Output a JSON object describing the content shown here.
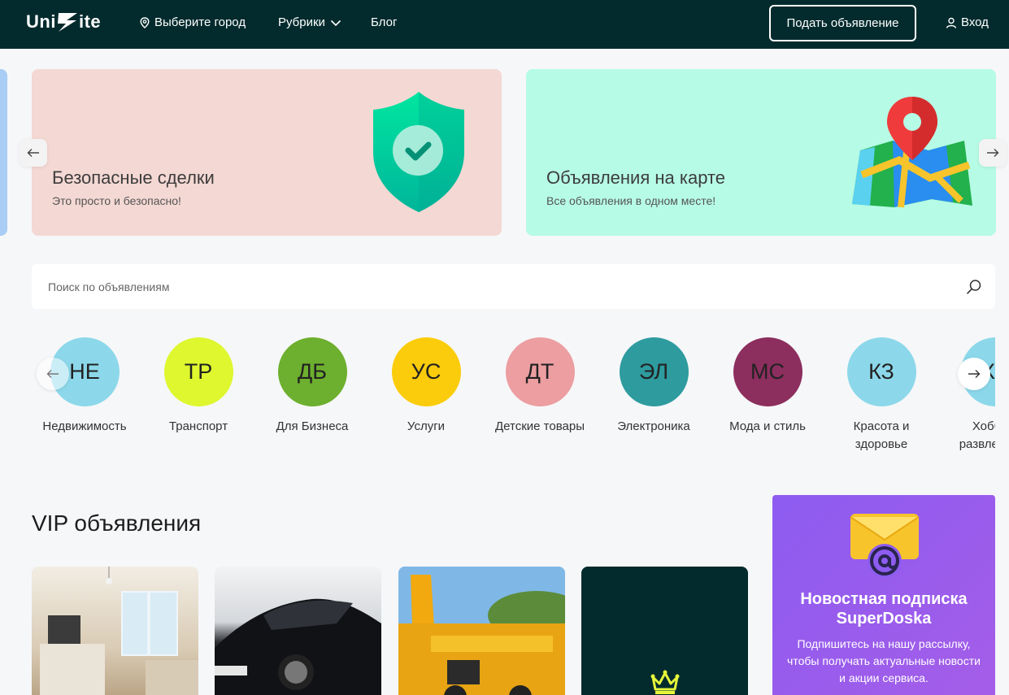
{
  "header": {
    "logo_left": "Uni",
    "logo_right": "ite",
    "city": "Выберите город",
    "rubrics": "Рубрики",
    "blog": "Блог",
    "post_ad": "Подать объявление",
    "login": "Вход"
  },
  "promos": [
    {
      "title": "Безопасные сделки",
      "subtitle": "Это просто и безопасно!",
      "icon": "shield-check-icon",
      "bg": "#f4d8d3"
    },
    {
      "title": "Объявления на карте",
      "subtitle": "Все объявления в одном месте!",
      "icon": "map-pin-icon",
      "bg": "#b6fbe5"
    }
  ],
  "search": {
    "placeholder": "Поиск по объявлениям",
    "value": ""
  },
  "categories": [
    {
      "abbr": "НЕ",
      "label": "Недвижимость",
      "color": "#8cd8ea"
    },
    {
      "abbr": "ТР",
      "label": "Транспорт",
      "color": "#def72e"
    },
    {
      "abbr": "ДБ",
      "label": "Для Бизнеса",
      "color": "#6daf2e"
    },
    {
      "abbr": "УС",
      "label": "Услуги",
      "color": "#fbcc0b"
    },
    {
      "abbr": "ДТ",
      "label": "Детские товары",
      "color": "#ec9ea1"
    },
    {
      "abbr": "ЭЛ",
      "label": "Электроника",
      "color": "#2e9b9f"
    },
    {
      "abbr": "МС",
      "label": "Мода и стиль",
      "color": "#8c2e5e"
    },
    {
      "abbr": "КЗ",
      "label": "Красота и здоровье",
      "color": "#8cd8ea"
    },
    {
      "abbr": "ХР",
      "label": "Хобби и развлечения",
      "color": "#8cd8ea"
    }
  ],
  "vip": {
    "title": "VIP объявления"
  },
  "newsletter": {
    "title": "Новостная подписка SuperDoska",
    "text": "Подпишитесь на нашу рассылку, чтобы получать актуальные новости и акции сервиса."
  }
}
